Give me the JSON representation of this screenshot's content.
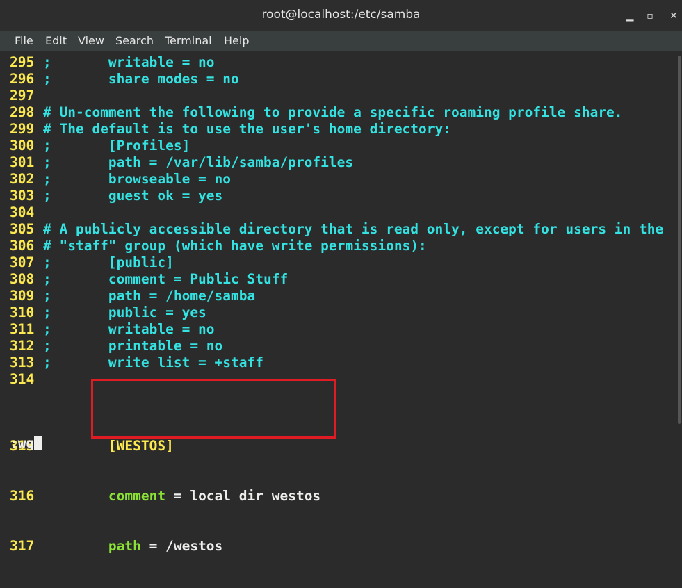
{
  "window": {
    "title": "root@localhost:/etc/samba",
    "minimize": "▁",
    "maximize": "▫",
    "close": "✕"
  },
  "menu": [
    "File",
    "Edit",
    "View",
    "Search",
    "Terminal",
    "Help"
  ],
  "lines": [
    {
      "n": "295",
      "a": ";       ",
      "b": "writable = no"
    },
    {
      "n": "296",
      "a": ";       ",
      "b": "share modes = no"
    },
    {
      "n": "297",
      "a": "",
      "b": ""
    },
    {
      "n": "298",
      "a": "# Un-comment the following to provide a specific roaming profile share.",
      "b": ""
    },
    {
      "n": "299",
      "a": "# The default is to use the user's home directory:",
      "b": ""
    },
    {
      "n": "300",
      "a": ";       ",
      "b": "[Profiles]"
    },
    {
      "n": "301",
      "a": ";       ",
      "b": "path = /var/lib/samba/profiles"
    },
    {
      "n": "302",
      "a": ";       ",
      "b": "browseable = no"
    },
    {
      "n": "303",
      "a": ";       ",
      "b": "guest ok = yes"
    },
    {
      "n": "304",
      "a": "",
      "b": ""
    },
    {
      "n": "305",
      "a": "# A publicly accessible directory that is read only, except for users in the",
      "b": ""
    },
    {
      "n": "306",
      "a": "# \"staff\" group (which have write permissions):",
      "b": ""
    },
    {
      "n": "307",
      "a": ";       ",
      "b": "[public]"
    },
    {
      "n": "308",
      "a": ";       ",
      "b": "comment = Public Stuff"
    },
    {
      "n": "309",
      "a": ";       ",
      "b": "path = /home/samba"
    },
    {
      "n": "310",
      "a": ";       ",
      "b": "public = yes"
    },
    {
      "n": "311",
      "a": ";       ",
      "b": "writable = no"
    },
    {
      "n": "312",
      "a": ";       ",
      "b": "printable = no"
    },
    {
      "n": "313",
      "a": ";       ",
      "b": "write list = +staff"
    },
    {
      "n": "314",
      "a": "",
      "b": ""
    }
  ],
  "westos": {
    "n315": "315",
    "section": "[WESTOS]",
    "n316": "316",
    "comment_key": "comment",
    "comment_val": " = local dir westos",
    "n317": "317",
    "path_key": "path",
    "path_val": " = /westos"
  },
  "command_line": ":wq",
  "colors": {
    "line_number": "#fce94f",
    "comment": "#34e2e2",
    "section": "#fce94f",
    "key": "#8ae234",
    "highlight_border": "#e01b24"
  }
}
